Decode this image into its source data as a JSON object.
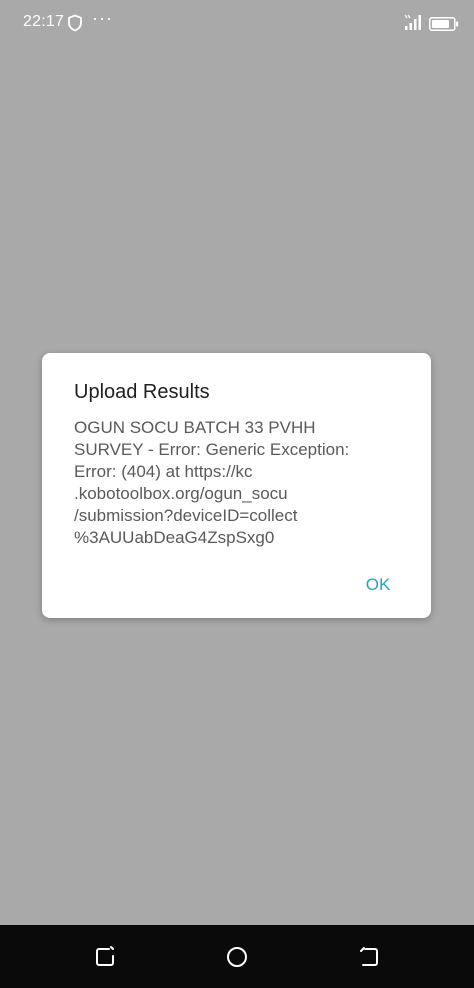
{
  "status_bar": {
    "time": "22:17",
    "dots": "···",
    "icons": [
      "shield-icon",
      "signal-icon",
      "battery-icon"
    ]
  },
  "dialog": {
    "title": "Upload Results",
    "message_lines": [
      "OGUN SOCU BATCH 33 PVHH",
      "SURVEY - Error: Generic Exception:",
      "Error:  (404) at https://kc",
      ".kobotoolbox.org/ogun_socu",
      "/submission?deviceID=collect",
      "%3AUUabDeaG4ZspSxg0"
    ],
    "ok_label": "OK"
  },
  "nav_bar": {
    "buttons": [
      "recents-icon",
      "home-icon",
      "back-icon"
    ]
  },
  "colors": {
    "backdrop": "#a9a9a9",
    "accent": "#2aa0c8",
    "nav_bar": "#0a0a0a"
  }
}
